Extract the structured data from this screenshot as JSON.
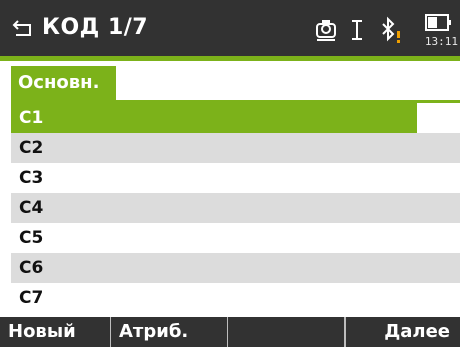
{
  "header": {
    "title": "КОД 1/7",
    "back_icon": "return-arrow-icon",
    "status_icons": [
      "target-prism-icon",
      "cursor-ibeam-icon",
      "bluetooth-warning-icon",
      "battery-icon"
    ],
    "clock": "13:11"
  },
  "tabs": [
    {
      "label": "Основн.",
      "active": true
    }
  ],
  "list": {
    "items": [
      {
        "label": "C1",
        "selected": true
      },
      {
        "label": "C2",
        "selected": false
      },
      {
        "label": "C3",
        "selected": false
      },
      {
        "label": "C4",
        "selected": false
      },
      {
        "label": "C5",
        "selected": false
      },
      {
        "label": "C6",
        "selected": false
      },
      {
        "label": "C7",
        "selected": false
      }
    ]
  },
  "softkeys": [
    "Новый",
    "Атриб.",
    "",
    "",
    "Далее"
  ],
  "colors": {
    "accent": "#7cb21a",
    "bar": "#323232",
    "alt_row": "#dcdcdc",
    "warning": "#f0a000"
  }
}
